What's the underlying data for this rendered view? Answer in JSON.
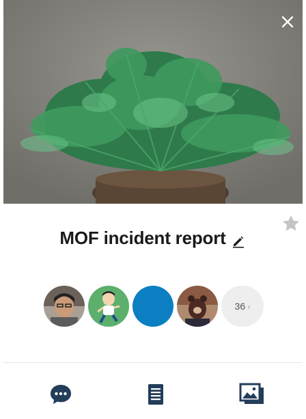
{
  "header": {
    "cover_alt": "green plant in pot",
    "close_icon": "close-icon",
    "star_icon": "star-icon"
  },
  "title": {
    "text": "MOF incident report",
    "edit_icon": "pencil-icon"
  },
  "members": {
    "avatars": [
      {
        "name": "member-1",
        "color": "#6b6158"
      },
      {
        "name": "member-2",
        "color": "#5daf6c"
      },
      {
        "name": "member-3",
        "color": "#0b7fc1"
      },
      {
        "name": "member-4",
        "color": "#8a5a44"
      }
    ],
    "more_count": "36",
    "more_chevron": "›"
  },
  "toolbar": {
    "chat_icon": "chat-bubble-icon",
    "notes_icon": "document-icon",
    "gallery_icon": "gallery-icon",
    "icon_color": "#233d5a"
  },
  "colors": {
    "title": "#1a1a1a",
    "star": "#c4c4c4",
    "chip_bg": "#eeeeee"
  }
}
